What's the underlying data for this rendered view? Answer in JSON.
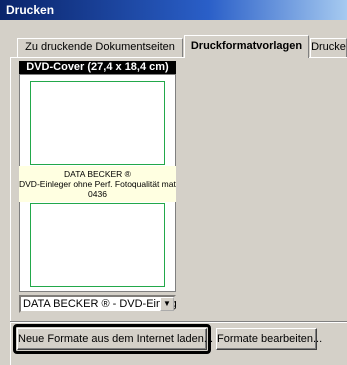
{
  "window": {
    "title": "Drucken"
  },
  "tabs": [
    {
      "label": "Zu druckende Dokumentseiten"
    },
    {
      "label": "Druckformatvorlagen"
    },
    {
      "label": "Drucke"
    }
  ],
  "preview": {
    "header": "DVD-Cover (27,4 x 18,4 cm)",
    "tooltip": {
      "line1": "DATA BECKER ®",
      "line2": "DVD-Einleger ohne Perf. Fotoqualität matt",
      "line3": "0436"
    }
  },
  "format_select": {
    "value": "DATA BECKER ® - DVD-Einleg"
  },
  "buttons": {
    "load_formats": "Neue Formate aus dem Internet laden...",
    "edit_formats": "Formate bearbeiten..."
  }
}
